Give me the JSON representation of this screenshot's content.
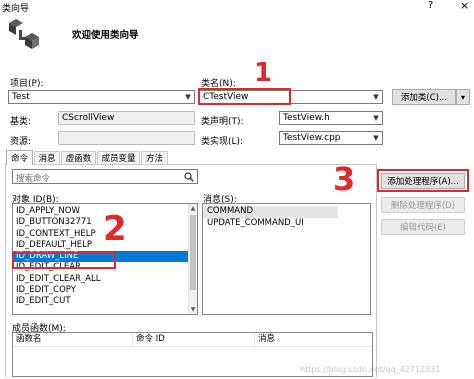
{
  "window": {
    "title": "类向导",
    "help_glyph": "?",
    "close_glyph": "×"
  },
  "header": {
    "welcome": "欢迎使用类向导"
  },
  "form": {
    "project_label": "项目(P):",
    "project_value": "Test",
    "classname_label": "类名(N):",
    "classname_value": "CTestView",
    "add_class_button": "添加类(C)...",
    "add_class_dropdown": "▾",
    "base_label": "基类:",
    "base_value": "CScrollView",
    "header_label": "类声明(T):",
    "header_value": "TestView.h",
    "resource_label": "资源:",
    "resource_value": "",
    "impl_label": "类实现(L):",
    "impl_value": "TestView.cpp"
  },
  "tabs": [
    {
      "label": "命令"
    },
    {
      "label": "消息"
    },
    {
      "label": "虚函数"
    },
    {
      "label": "成员变量"
    },
    {
      "label": "方法"
    }
  ],
  "search": {
    "placeholder": "搜索命令"
  },
  "object_ids": {
    "label": "对象 ID(B):",
    "items": [
      "ID_APPLY_NOW",
      "ID_BUTTON32771",
      "ID_CONTEXT_HELP",
      "ID_DEFAULT_HELP",
      "ID_DRAW_LINE",
      "ID_EDIT_CLEAR",
      "ID_EDIT_CLEAR_ALL",
      "ID_EDIT_COPY",
      "ID_EDIT_CUT"
    ],
    "selected_index": 4
  },
  "messages": {
    "label": "消息(S):",
    "items": [
      "COMMAND",
      "UPDATE_COMMAND_UI"
    ]
  },
  "actions": {
    "add_handler": "添加处理程序(A)...",
    "delete_handler": "删除处理程序(D)",
    "edit_code": "编辑代码(E)"
  },
  "member_functions": {
    "label": "成员函数(M):",
    "columns": [
      "函数名",
      "命令 ID",
      "消息"
    ]
  },
  "annotations": {
    "n1": "1",
    "n2": "2",
    "n3": "3",
    "color": "#e0282e"
  },
  "watermark": "https://blog.csdn.net/qq_42712331"
}
